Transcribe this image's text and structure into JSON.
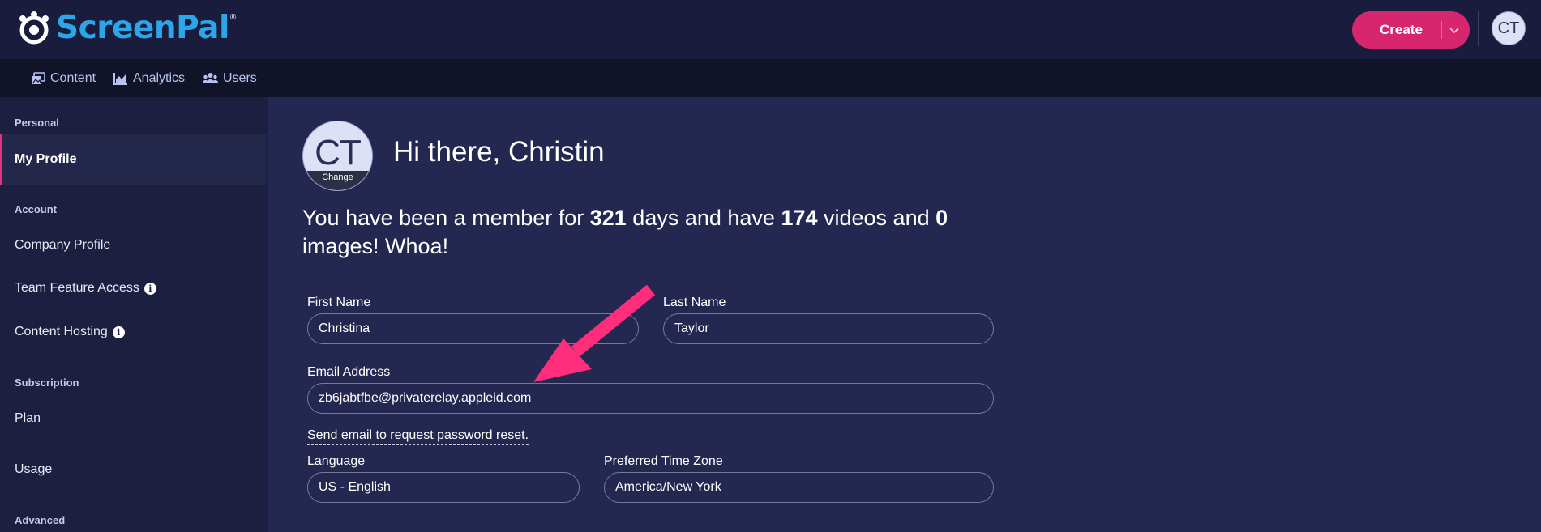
{
  "header": {
    "logo_text": "ScreenPal",
    "logo_mark": "®",
    "create_label": "Create",
    "avatar_initials": "CT"
  },
  "nav": {
    "items": [
      {
        "label": "Content",
        "icon": "content-icon"
      },
      {
        "label": "Analytics",
        "icon": "analytics-icon"
      },
      {
        "label": "Users",
        "icon": "users-icon"
      }
    ]
  },
  "sidebar": {
    "sections": {
      "personal": "Personal",
      "account": "Account",
      "subscription": "Subscription",
      "advanced": "Advanced"
    },
    "items": {
      "my_profile": "My Profile",
      "company_profile": "Company Profile",
      "team_feature_access": "Team Feature Access",
      "content_hosting": "Content Hosting",
      "plan": "Plan",
      "usage": "Usage"
    },
    "info_glyph": "i"
  },
  "profile": {
    "avatar_initials": "CT",
    "change_label": "Change",
    "greeting": "Hi there, Christin",
    "member": {
      "prefix": "You have been a member for ",
      "days": "321",
      "mid1": " days and have ",
      "videos": "174",
      "mid2": " videos and ",
      "images": "0",
      "suffix": " images! Whoa!"
    }
  },
  "form": {
    "first_name_label": "First Name",
    "first_name_value": "Christina",
    "last_name_label": "Last Name",
    "last_name_value": "Taylor",
    "email_label": "Email Address",
    "email_value": "zb6jabtfbe@privaterelay.appleid.com",
    "reset_link": "Send email to request password reset.",
    "language_label": "Language",
    "language_value": "US - English",
    "timezone_label": "Preferred Time Zone",
    "timezone_value": "America/New York"
  },
  "colors": {
    "accent": "#d8266e",
    "arrow": "#ff2d7a",
    "brand_blue": "#2aa6e9"
  }
}
